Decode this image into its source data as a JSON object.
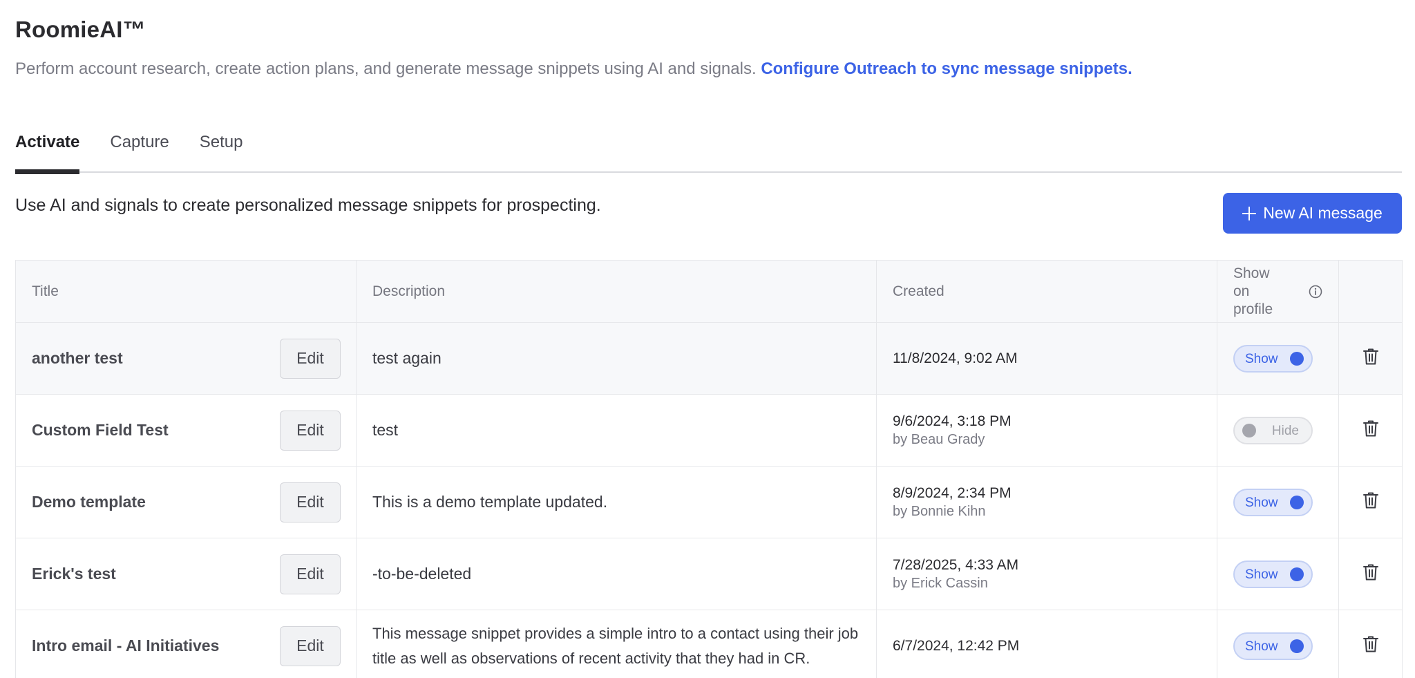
{
  "app": {
    "title": "RoomieAI™",
    "subtitle": "Perform account research, create action plans, and generate message snippets using AI and signals.",
    "subtitle_link": "Configure Outreach to sync message snippets."
  },
  "tabs": [
    {
      "label": "Activate",
      "active": true
    },
    {
      "label": "Capture",
      "active": false
    },
    {
      "label": "Setup",
      "active": false
    }
  ],
  "activate": {
    "intro": "Use AI and signals to create personalized message snippets for prospecting.",
    "new_button_label": "New AI message"
  },
  "table": {
    "headers": {
      "title": "Title",
      "description": "Description",
      "created": "Created",
      "show_on_profile_line1": "Show",
      "show_on_profile_line2": "on",
      "show_on_profile_line3": "profile"
    },
    "edit_label": "Edit",
    "rows": [
      {
        "title": "another test",
        "description": "test again",
        "created": "11/8/2024, 9:02 AM",
        "created_by": "",
        "toggle": "Show"
      },
      {
        "title": "Custom Field Test",
        "description": "test",
        "created": "9/6/2024, 3:18 PM",
        "created_by": "by Beau Grady",
        "toggle": "Hide"
      },
      {
        "title": "Demo template",
        "description": "This is a demo template updated.",
        "created": "8/9/2024, 2:34 PM",
        "created_by": "by Bonnie Kihn",
        "toggle": "Show"
      },
      {
        "title": "Erick's test",
        "description": "-to-be-deleted",
        "created": "7/28/2025, 4:33 AM",
        "created_by": "by Erick Cassin",
        "toggle": "Show"
      },
      {
        "title": "Intro email - AI Initiatives",
        "description": "This message snippet provides a simple intro to a contact using their job title as well as observations of recent activity that they had in CR.",
        "created": "6/7/2024, 12:42 PM",
        "created_by": "",
        "toggle": "Show"
      }
    ]
  },
  "colors": {
    "accent": "#3c63e6",
    "toggle_on_bg": "#e3e9fb",
    "toggle_off_bg": "#f1f2f4"
  },
  "icons": {
    "new_button": "plus-icon",
    "header_info": "info-icon",
    "row_delete": "trash-icon"
  }
}
